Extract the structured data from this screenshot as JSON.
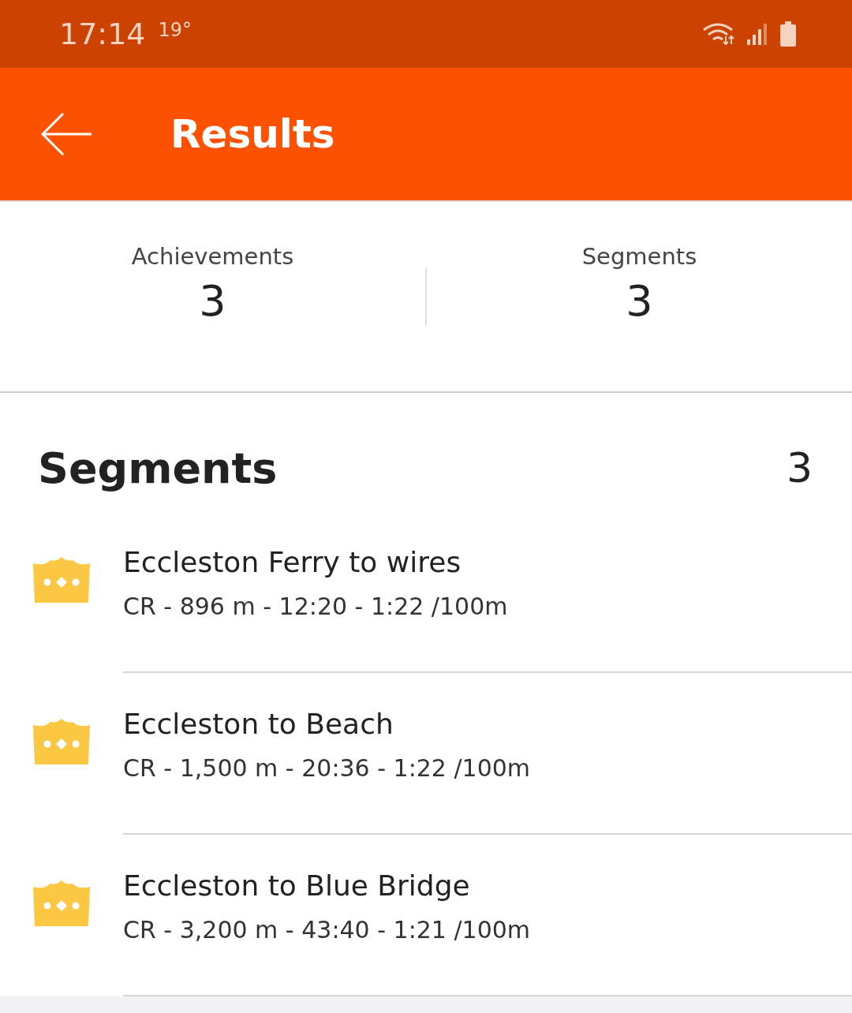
{
  "status_bar": {
    "time": "17:14",
    "temperature": "19°"
  },
  "header": {
    "title": "Results"
  },
  "summary": [
    {
      "label": "Achievements",
      "value": "3"
    },
    {
      "label": "Segments",
      "value": "3"
    }
  ],
  "segments": {
    "title": "Segments",
    "count": "3",
    "items": [
      {
        "name": "Eccleston Ferry to wires",
        "details": "CR - 896 m - 12:20 - 1:22 /100m"
      },
      {
        "name": "Eccleston to Beach",
        "details": "CR - 1,500 m - 20:36 - 1:22 /100m"
      },
      {
        "name": "Eccleston to Blue Bridge",
        "details": "CR - 3,200 m - 43:40 - 1:21 /100m"
      }
    ]
  }
}
